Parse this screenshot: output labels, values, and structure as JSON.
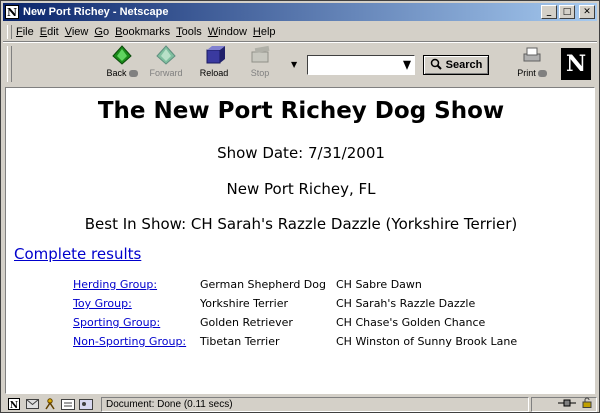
{
  "window": {
    "title": "New Port Richey - Netscape",
    "icon": "netscape-n-icon"
  },
  "menu": {
    "items": [
      {
        "label": "File",
        "u": "F",
        "rest": "ile"
      },
      {
        "label": "Edit",
        "u": "E",
        "rest": "dit"
      },
      {
        "label": "View",
        "u": "V",
        "rest": "iew"
      },
      {
        "label": "Go",
        "u": "G",
        "rest": "o"
      },
      {
        "label": "Bookmarks",
        "u": "B",
        "rest": "ookmarks"
      },
      {
        "label": "Tools",
        "u": "T",
        "rest": "ools"
      },
      {
        "label": "Window",
        "u": "W",
        "rest": "indow"
      },
      {
        "label": "Help",
        "u": "H",
        "rest": "elp"
      }
    ]
  },
  "toolbar": {
    "back": "Back",
    "forward": "Forward",
    "reload": "Reload",
    "stop": "Stop",
    "search_button": "Search",
    "search_value": "",
    "print": "Print",
    "logo": "N"
  },
  "page": {
    "title": "The New Port Richey Dog Show",
    "show_date": "Show Date: 7/31/2001",
    "location": "New Port Richey, FL",
    "best_in_show": "Best In Show: CH Sarah's Razzle Dazzle (Yorkshire Terrier)",
    "complete_results_link": "Complete results",
    "groups": [
      {
        "group": "Herding Group:",
        "breed": "German Shepherd Dog",
        "winner": "CH Sabre Dawn"
      },
      {
        "group": "Toy Group:",
        "breed": "Yorkshire Terrier",
        "winner": "CH Sarah's Razzle Dazzle"
      },
      {
        "group": "Sporting Group:",
        "breed": "Golden Retriever",
        "winner": "CH Chase's Golden Chance"
      },
      {
        "group": "Non-Sporting Group:",
        "breed": "Tibetan Terrier",
        "winner": "CH Winston of Sunny Brook Lane"
      }
    ]
  },
  "status": {
    "text": "Document: Done (0.11 secs)"
  }
}
